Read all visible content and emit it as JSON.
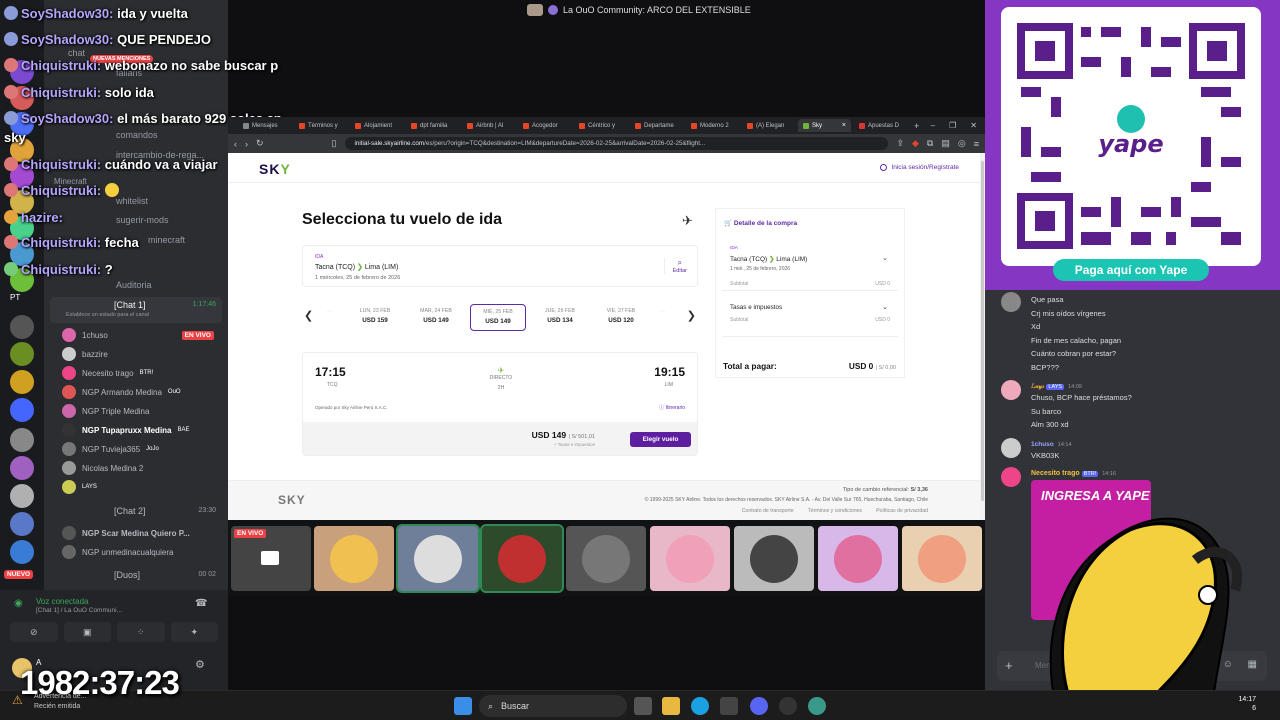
{
  "top_banner": {
    "text": "La OuO Community: ARCO DEL EXTENSIBLE"
  },
  "overlay_chat": [
    {
      "name": "SoyShadow30:",
      "msg": "ida y vuelta"
    },
    {
      "name": "SoyShadow30:",
      "msg": "QUE PENDEJO"
    },
    {
      "name": "Chiquistruki:",
      "msg": "webonazo no sabe buscar p"
    },
    {
      "name": "Chiquistruki:",
      "msg": "solo ida"
    },
    {
      "name": "SoyShadow30:",
      "msg": "el más barato 929 soles en"
    },
    {
      "name": "",
      "msg": "sky"
    },
    {
      "name": "Chiquistruki:",
      "msg": "cuándo va a viajar"
    },
    {
      "name": "Chiquistruki:",
      "msg": ""
    },
    {
      "name": "hazire:",
      "msg": ""
    },
    {
      "name": "Chiquistruki:",
      "msg": "fecha"
    },
    {
      "name": "Chiquistruki:",
      "msg": "?"
    }
  ],
  "discord_left": {
    "channels": [
      "chat",
      "fallaris",
      "comandos",
      "intercambio-de-rega...",
      "Minecraft",
      "whitelist",
      "sugerir-mods",
      "minecraft",
      "Auditoria"
    ],
    "new_mentions": "NUEVAS MENCIONES",
    "voice_channel_1": "[Chat 1]",
    "voice_channel_1_time": "1:17:46",
    "voice_channel_1_status": "Establece un estado para el canal",
    "voice_users": [
      "1chuso",
      "bazzire",
      "Necesito trago",
      "NGP Armando Medina",
      "NGP Triple Medina",
      "NGP Tupapruxx Medina",
      "NGP Tuvieja365",
      "Nicolas Medina 2",
      "LAYS"
    ],
    "live_label": "EN VIVO",
    "voice_user_tags": [
      "BTR!",
      "OuO",
      "BAE",
      "JoJo",
      "LAYS"
    ],
    "voice_channel_2": "[Chat 2]",
    "voice_channel_2_time": "23:30",
    "voice_users_2": [
      "NGP Scar Medina Quiero P...",
      "NGP unmedinacualquiera"
    ],
    "voice_channel_3": "[Duos]",
    "voice_channel_3_count": "00 02",
    "voice_connected": "Voz conectada",
    "voice_connected_sub": "[Chat 1] / La OuO Communi...",
    "nuevo_label": "NUEVO",
    "guild_badges": [
      "10",
      "8",
      "34",
      "2",
      "17",
      "3",
      "30",
      "8",
      "6",
      "8",
      "68",
      "7"
    ],
    "user_prefix": "A",
    "pt_label": "PT"
  },
  "browser": {
    "tabs": [
      "Mensajes",
      "Términos y",
      "Alojamient",
      "dpt familia",
      "Airbnb | Al",
      "Acogedor",
      "Céntrico y",
      "Departame",
      "Moderno 2",
      "(A) Elegan",
      "Sky",
      "Apuestas D"
    ],
    "active_tab_index": 10,
    "url_host": "initial-sale.skyairline.com",
    "url_path": "/es/peru?origin=TCQ&destination=LIM&departureDate=2026-02-25&arrivalDate=2026-02-25&flight..."
  },
  "sky": {
    "logo_a": "S",
    "logo_b": "K",
    "logo_c": "Y",
    "login": "Inicia sesión/Regístrate",
    "title": "Selecciona tu vuelo de ida",
    "route_label": "IDA",
    "origin": "Tacna (TCQ)",
    "destination": "Lima (LIM)",
    "date_line": "1  miércoles, 25 de febrero de 2026",
    "edit": "Editar",
    "dates": [
      {
        "day": "LUN, 23 FEB",
        "price": "USD 159"
      },
      {
        "day": "MAR, 24 FEB",
        "price": "USD 149"
      },
      {
        "day": "MIÉ, 25 FEB",
        "price": "USD 149"
      },
      {
        "day": "JUE, 26 FEB",
        "price": "USD 134"
      },
      {
        "day": "VIE, 27 FEB",
        "price": "USD 120"
      }
    ],
    "selected_date_index": 2,
    "flight": {
      "dep_time": "17:15",
      "dep_code": "TCQ",
      "arr_time": "19:15",
      "arr_code": "LIM",
      "type": "DIRECTO",
      "duration": "2H",
      "operator": "Operado por Sky Airline Perú S.A.C.",
      "itinerary": "Itinerario",
      "price": "USD 149",
      "price_alt": "| S/ 501,01",
      "taxes_note": "+ Tasas e impuestos",
      "button": "Elegir vuelo"
    },
    "summary": {
      "title": "Detalle de la compra",
      "leg_label": "IDA",
      "origin": "Tacna (TCQ)",
      "destination": "Lima (LIM)",
      "date": "1  mié., 25 de febrero, 2026",
      "subtotal_label": "Subtotal",
      "subtotal_value": "USD 0",
      "taxes_label": "Tasas e impuestos",
      "taxes_subtotal_label": "Subtotal",
      "taxes_subtotal_value": "USD 0",
      "total_label": "Total a pagar:",
      "total_value": "USD 0",
      "total_alt": "| S/ 0,00"
    },
    "footer": {
      "logo": "SKY",
      "rate_label": "Tipo de cambio referencial:",
      "rate_value": "S/ 3,36",
      "copyright": "© 1999-2025 SKY Airline. Todos los derechos reservados. SKY Airline S.A. - Av. Del Valle Sur 765, Huechuraba, Santiago, Chile",
      "links": [
        "Contrato de transporte",
        "Términos y condiciones",
        "Políticas de privacidad"
      ]
    }
  },
  "tiles": {
    "live_label": "EN VIVO"
  },
  "right_panel": {
    "qr_caption": "Paga aquí con Yape",
    "chat": [
      {
        "name": "",
        "msg": "Que pasa",
        "time": ""
      },
      {
        "name": "",
        "msg": "Crj mis oídos vírgenes",
        "time": ""
      },
      {
        "name": "",
        "msg": "Xd",
        "time": ""
      },
      {
        "name": "",
        "msg": "Fin de mes calacho, pagan",
        "time": ""
      },
      {
        "name": "",
        "msg": "Cuánto cobran por estar?",
        "time": ""
      },
      {
        "name": "",
        "msg": "BCP???",
        "time": ""
      },
      {
        "name": "LAYS",
        "msg": "Chuso, BCP hace préstamos?",
        "time": "14:09"
      },
      {
        "name": "",
        "msg": "Su barco",
        "time": ""
      },
      {
        "name": "",
        "msg": "Alm 300 xd",
        "time": ""
      },
      {
        "name": "1chuso",
        "msg": "VKB03K",
        "time": "14:14"
      },
      {
        "name": "Necesito trago",
        "msg": "",
        "time": "14:16"
      }
    ],
    "chat_tag": "BTR!",
    "yape_text": "INGRESA A YAPE",
    "input_placeholder": "Mensaje"
  },
  "taskbar": {
    "search": "Buscar",
    "time": "14:17",
    "date": "6"
  },
  "overlay": {
    "timer": "1982:37:23",
    "warning_title": "Advertencia de...",
    "warning_sub": "Recién emitida"
  },
  "colors": {
    "sky_purple": "#5d1fa0",
    "sky_green": "#71b340",
    "discord_bg": "#2b2d31",
    "yape_purple": "#8537c4",
    "yape_teal": "#1cc4b4",
    "live_red": "#ed4245"
  }
}
